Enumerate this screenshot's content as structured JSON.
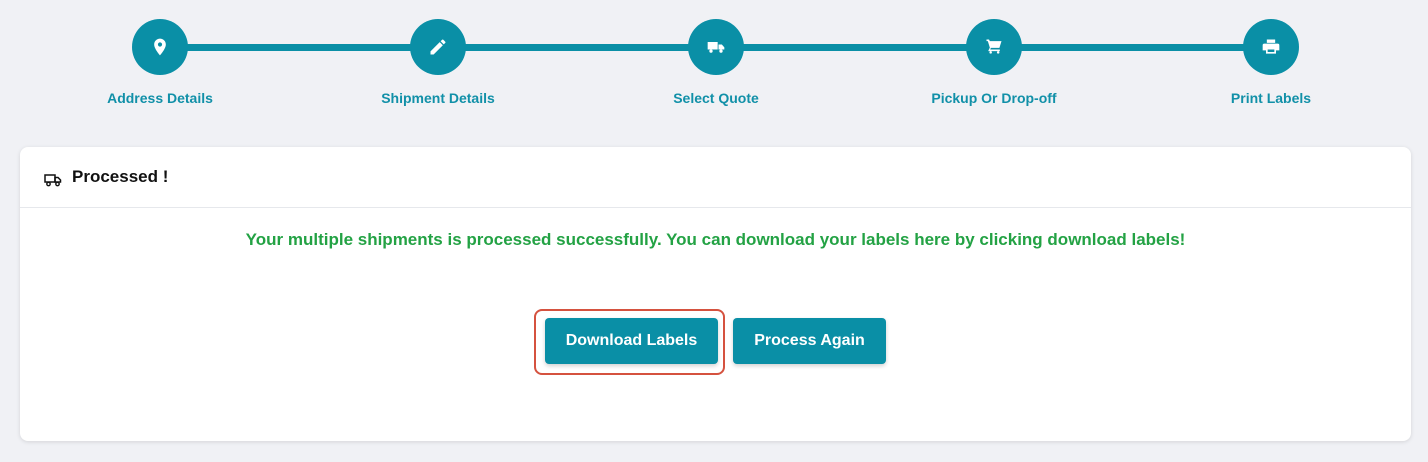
{
  "steps": [
    {
      "label": "Address Details",
      "icon": "map-marker-icon"
    },
    {
      "label": "Shipment Details",
      "icon": "pencil-icon"
    },
    {
      "label": "Select Quote",
      "icon": "truck-icon"
    },
    {
      "label": "Pickup Or Drop-off",
      "icon": "cart-icon"
    },
    {
      "label": "Print Labels",
      "icon": "printer-icon"
    }
  ],
  "card": {
    "title": "Processed !",
    "icon": "truck-outline-icon",
    "message": "Your multiple shipments is processed successfully. You can download your labels here by clicking download labels!"
  },
  "actions": {
    "download_label": "Download Labels",
    "process_again_label": "Process Again"
  },
  "colors": {
    "accent": "#0a8fa6",
    "success": "#23a244",
    "highlight": "#d5523f",
    "background": "#f0f1f5"
  }
}
